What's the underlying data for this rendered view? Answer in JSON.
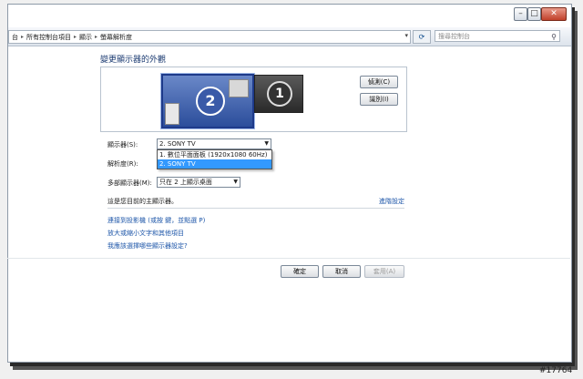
{
  "window_controls": {
    "minimize": "–",
    "maximize": "□",
    "close": "✕"
  },
  "address": {
    "breadcrumbs": [
      "台",
      "所有控制台項目",
      "顯示",
      "螢幕解析度"
    ],
    "refresh_icon": "refresh-icon",
    "search_placeholder": "搜尋控制台"
  },
  "heading": "變更顯示器的外觀",
  "monitors": [
    {
      "number": "2",
      "selected": true
    },
    {
      "number": "1",
      "selected": false
    }
  ],
  "buttons": {
    "detect": "偵測(C)",
    "identify": "識別(I)",
    "ok": "確定",
    "cancel": "取消",
    "apply": "套用(A)"
  },
  "display": {
    "label": "顯示器(S):",
    "value": "2. SONY TV",
    "options": [
      "1. 數位平面面板 (1920x1080 60Hz)",
      "2. SONY TV"
    ]
  },
  "resolution": {
    "label": "解析度(R):"
  },
  "multi_display": {
    "label": "多部顯示器(M):",
    "value": "只在 2 上顯示桌面"
  },
  "main_display_text": "這是您目前的主顯示器。",
  "advanced_link": "進階設定",
  "links": [
    "連接到投影機 (或按  鍵，並點選 P)",
    "放大或縮小文字和其他項目",
    "我應該選擇哪些顯示器設定?"
  ],
  "watermark": "#17764"
}
